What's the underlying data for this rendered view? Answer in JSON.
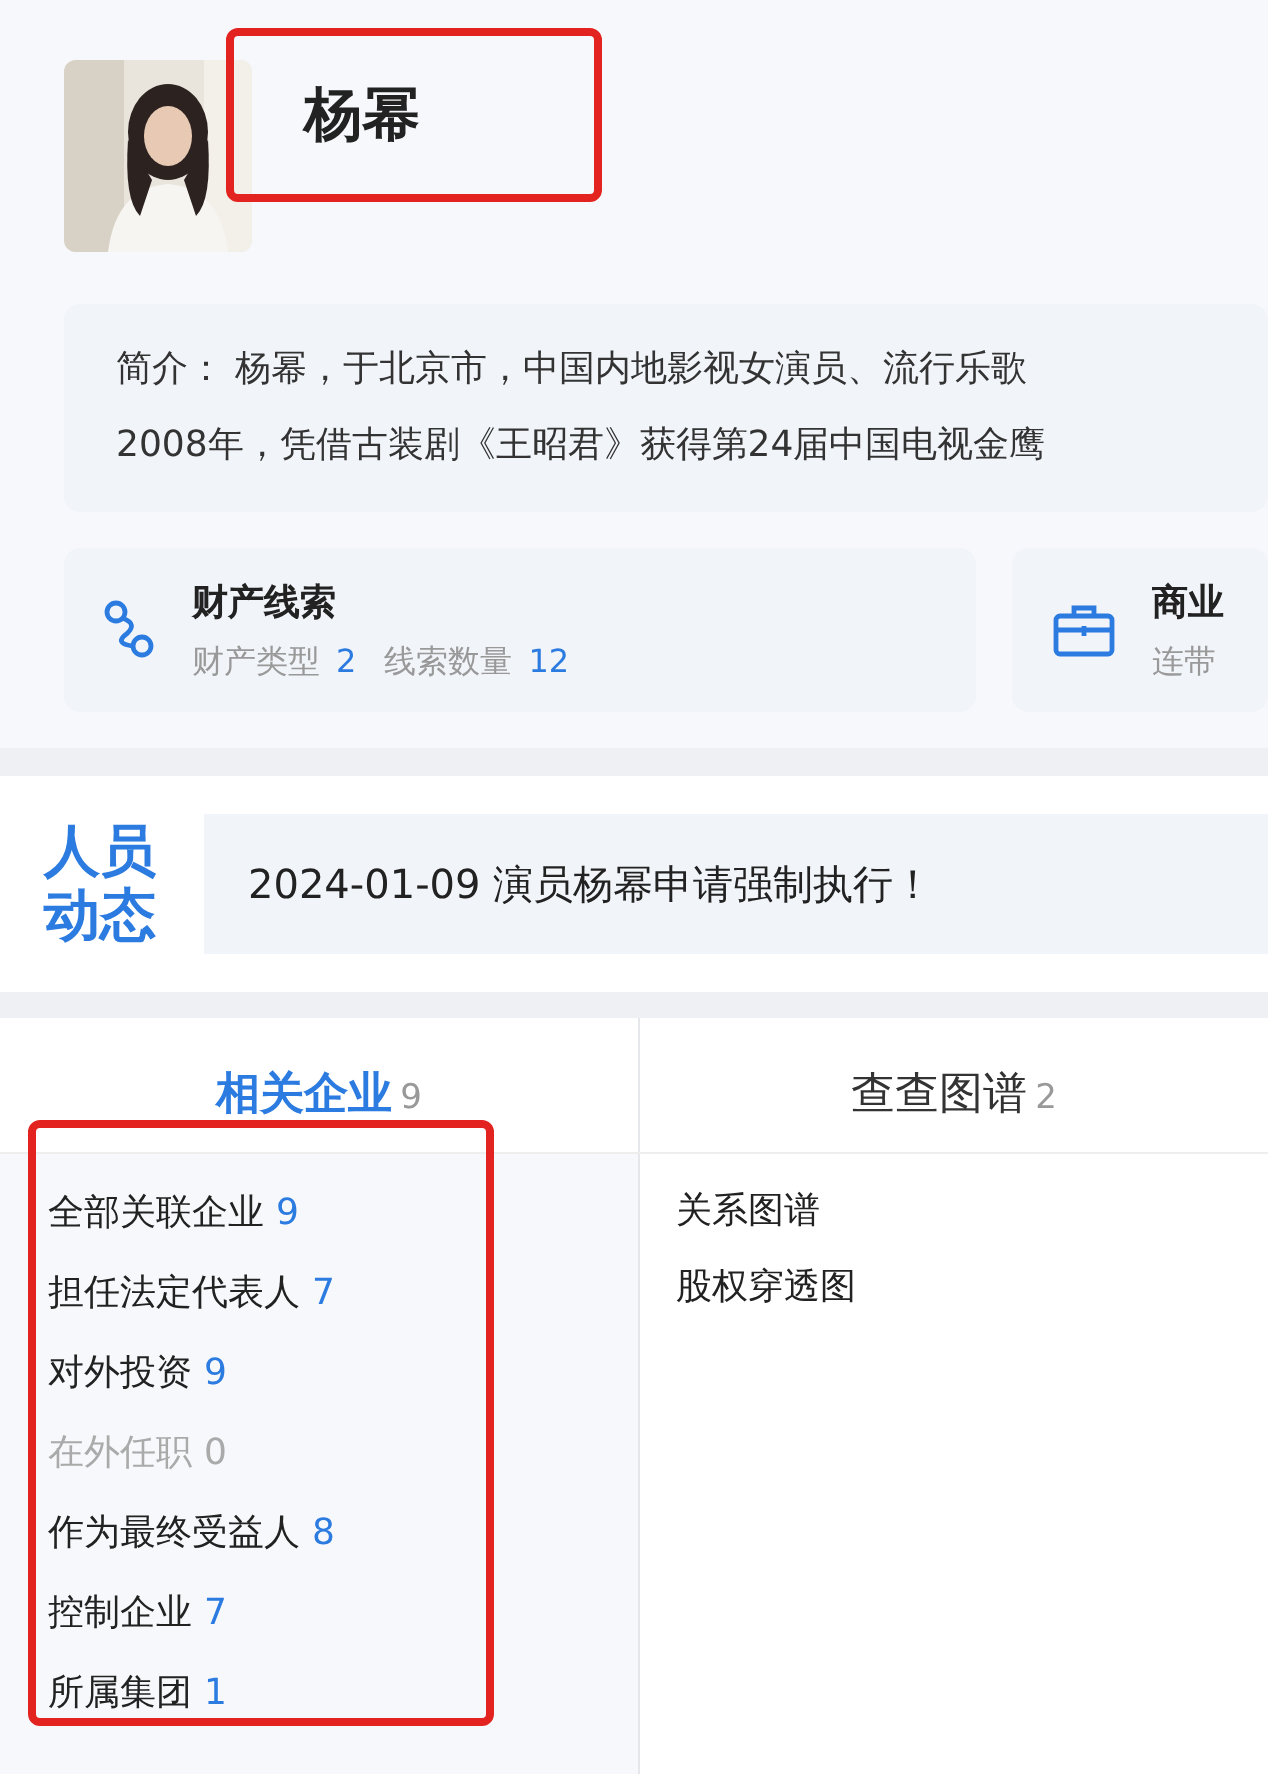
{
  "profile": {
    "name": "杨幂"
  },
  "intro": {
    "lines": [
      "简介： 杨幂，于北京市，中国内地影视女演员、流行乐歌",
      "2008年，凭借古装剧《王昭君》获得第24届中国电视金鹰"
    ]
  },
  "cards": [
    {
      "kind": "clue",
      "title": "财产线索",
      "stats": [
        {
          "label": "财产类型",
          "value": "2"
        },
        {
          "label": "线索数量",
          "value": "12"
        }
      ]
    },
    {
      "kind": "case",
      "title": "商业",
      "stats": [
        {
          "label": "连带"
        }
      ]
    }
  ],
  "news": {
    "heading": "人员动态",
    "text": "2024-01-09 演员杨幂申请强制执行！"
  },
  "tabs": [
    {
      "label": "相关企业",
      "count": "9",
      "selected": true
    },
    {
      "label": "查查图谱",
      "count": "2",
      "selected": false
    }
  ],
  "companies": [
    {
      "label": "全部关联企业",
      "count": "9",
      "disabled": false
    },
    {
      "label": "担任法定代表人",
      "count": "7",
      "disabled": false
    },
    {
      "label": "对外投资",
      "count": "9",
      "disabled": false
    },
    {
      "label": "在外任职",
      "count": "0",
      "disabled": true
    },
    {
      "label": "作为最终受益人",
      "count": "8",
      "disabled": false
    },
    {
      "label": "控制企业",
      "count": "7",
      "disabled": false
    },
    {
      "label": "所属集团",
      "count": "1",
      "disabled": false
    }
  ],
  "graphs": [
    "关系图谱",
    "股权穿透图"
  ]
}
